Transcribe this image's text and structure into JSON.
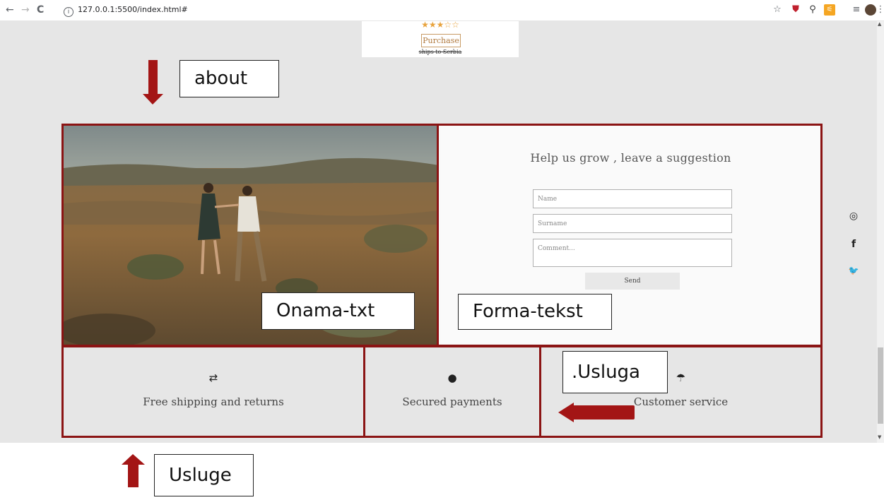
{
  "browser": {
    "url": "127.0.0.1:5500/index.html#",
    "info_symbol": "ⓘ",
    "nav": {
      "back": "←",
      "forward": "→",
      "reload": "C"
    },
    "toolbar_icons": [
      "☆",
      "⛊",
      "🔍",
      "◼",
      "≡",
      "●",
      "⋮"
    ]
  },
  "product": {
    "stars": "★★★☆☆",
    "purchase_label": "Purchase",
    "ships_text": "ships to Serbia"
  },
  "form": {
    "title": "Help us grow , leave a suggestion",
    "name_placeholder": "Name",
    "surname_placeholder": "Surname",
    "comment_placeholder": "Comment...",
    "send_label": "Send"
  },
  "services": [
    {
      "icon": "⇄",
      "icon_name": "retweet-icon",
      "label": "Free shipping and returns"
    },
    {
      "icon": "🔒",
      "icon_name": "lock-icon",
      "label": "Secured payments"
    },
    {
      "icon": "☂",
      "icon_name": "umbrella-icon",
      "label": "Customer service"
    }
  ],
  "social": {
    "instagram": "◎",
    "facebook": "f",
    "twitter": "🐦"
  },
  "annotations": {
    "about": "about",
    "onama": "Onama-txt",
    "forma": "Forma-tekst",
    "usluga": ".Usluga",
    "usluge": "Usluge"
  },
  "colors": {
    "accent_border": "#8b1414",
    "arrow": "#a31515",
    "star": "#e8a33d",
    "page_bg": "#e6e6e6"
  }
}
